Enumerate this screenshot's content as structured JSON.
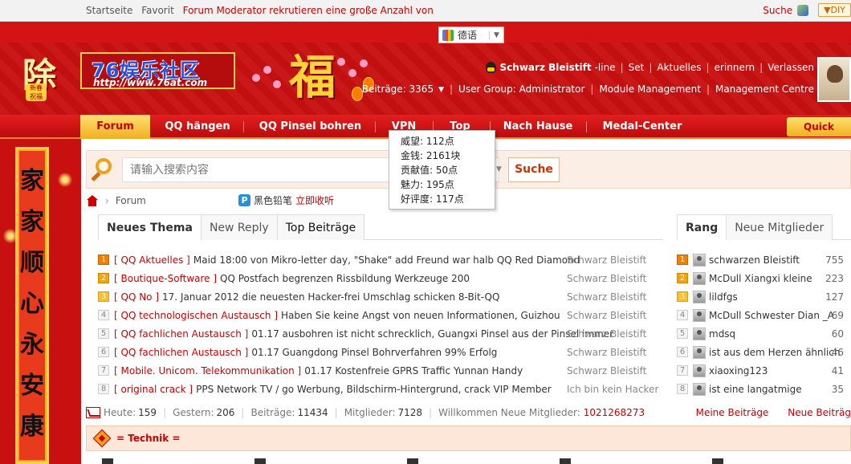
{
  "topbar": {
    "links": [
      "Startseite",
      "Favorit"
    ],
    "marquee": "Forum Moderator rekrutieren eine große Anzahl von",
    "search_label": "Suche",
    "diy_label": "▼DIY"
  },
  "translate": {
    "language": "德语",
    "arrow": "▼"
  },
  "brand": {
    "logo_char": "除",
    "seal": "新春\n祝福",
    "name": "76娱乐社区",
    "url": "http://www.76at.com",
    "fu": "福"
  },
  "user": {
    "name": "Schwarz Bleistift",
    "status": "-line",
    "actions": [
      "Set",
      "Aktuelles",
      "erinnern",
      "Verlassen"
    ],
    "posts_label": "Beiträge: 3365",
    "posts_arrow": "▼",
    "group": "User Group: Administrator",
    "module": "Module Management",
    "centre": "Management Centre"
  },
  "nav": {
    "items": [
      "Forum",
      "QQ hängen",
      "QQ Pinsel bohren",
      "VPN",
      "Top",
      "Nach Hause",
      "Medal-Center"
    ],
    "quick": "Quick"
  },
  "tooltip": {
    "lines": [
      "威望: 112点",
      "金钱: 2161块",
      "贡献值: 50点",
      "魅力: 195点",
      "好评度: 117点"
    ]
  },
  "banner": {
    "chars": [
      "家",
      "家",
      "顺",
      "心",
      "永",
      "安",
      "康"
    ]
  },
  "search": {
    "placeholder": "请输入搜索内容",
    "arrow": "▼",
    "button": "Suche"
  },
  "breadcrumb": {
    "chevron": "›",
    "current": "Forum"
  },
  "promo": {
    "icon": "P",
    "name": "黑色铅笔",
    "action": "立即收听"
  },
  "left_tabs": [
    "Neues Thema",
    "New Reply",
    "Top Beiträge"
  ],
  "right_tabs": [
    "Rang",
    "Neue Mitglieder"
  ],
  "threads": [
    {
      "rank": "1",
      "category": "[ QQ Aktuelles ]",
      "title": "Maid 18:00 von Mikro-letter day, \"Shake\" add Freund war halb QQ Red Diamond",
      "author": "Schwarz Bleistift"
    },
    {
      "rank": "2",
      "category": "[ Boutique-Software ]",
      "title": "QQ Postfach begrenzen Rissbildung Werkzeuge 200",
      "author": "Schwarz Bleistift"
    },
    {
      "rank": "3",
      "category": "[ QQ No ]",
      "title": "17. Januar 2012 die neuesten Hacker-frei Umschlag schicken 8-Bit-QQ",
      "author": "Schwarz Bleistift"
    },
    {
      "rank": "4",
      "category": "[ QQ technologischen Austausch ]",
      "title": "Haben Sie keine Angst von neuen Informationen, Guizhou",
      "author": "Schwarz Bleistift"
    },
    {
      "rank": "5",
      "category": "[ QQ fachlichen Austausch ]",
      "title": "01.17 ausbohren ist nicht schrecklich, Guangxi Pinsel aus der Pinsel immer",
      "author": "Schwarz Bleistift"
    },
    {
      "rank": "6",
      "category": "[ QQ fachlichen Austausch ]",
      "title": "01.17 Guangdong Pinsel Bohrverfahren 99% Erfolg",
      "author": "Schwarz Bleistift"
    },
    {
      "rank": "7",
      "category": "[ Mobile. Unicom. Telekommunikation ]",
      "title": "01.17 Kostenfreie GPRS Traffic Yunnan Handy",
      "author": "Schwarz Bleistift"
    },
    {
      "rank": "8",
      "category": "[ original crack ]",
      "title": "PPS Network TV / go Werbung, Bildschirm-Hintergrund, crack VIP Member",
      "author": "Ich bin kein Hacker"
    }
  ],
  "ranking": [
    {
      "rank": "1",
      "name": "schwarzen Bleistift",
      "count": "755"
    },
    {
      "rank": "2",
      "name": "McDull Xiangxi kleine",
      "count": "223"
    },
    {
      "rank": "3",
      "name": "lildfgs",
      "count": "127"
    },
    {
      "rank": "4",
      "name": "McDull Schwester Dian _A",
      "count": "69"
    },
    {
      "rank": "5",
      "name": "mdsq",
      "count": "60"
    },
    {
      "rank": "6",
      "name": "ist aus dem Herzen ähnlich",
      "count": "46"
    },
    {
      "rank": "7",
      "name": "xiaoxing123",
      "count": "41"
    },
    {
      "rank": "8",
      "name": "ist eine langatmige",
      "count": "35"
    }
  ],
  "stats": {
    "today_label": "Heute:",
    "today": "159",
    "yesterday_label": "Gestern:",
    "yesterday": "206",
    "posts_label": "Beiträge:",
    "posts": "11434",
    "members_label": "Mitglieder:",
    "members": "7128",
    "welcome_label": "Willkommen Neue Mitglieder:",
    "newest": "1021268273",
    "my_posts": "Meine Beiträge",
    "new_posts": "Neue Beiträg"
  },
  "section": {
    "title": "= Technik ="
  },
  "colors": {
    "brand_red": "#c81010",
    "accent_gold": "#f0b020",
    "link_red": "#cc0000"
  }
}
